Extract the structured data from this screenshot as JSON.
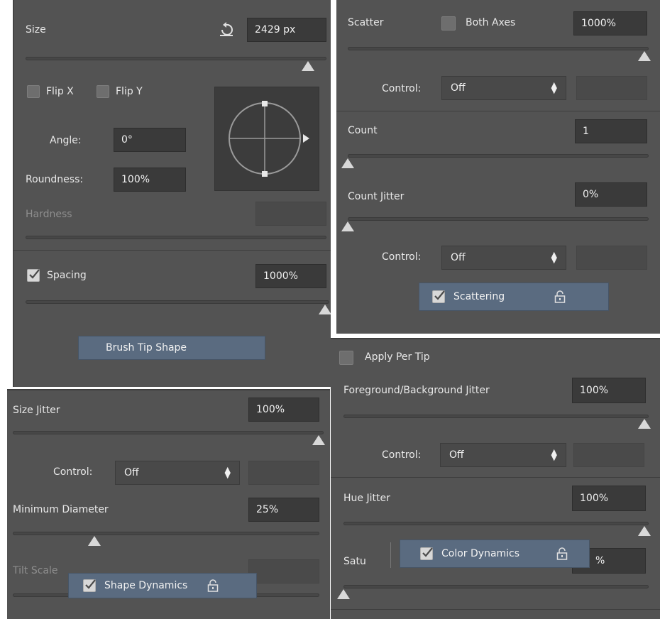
{
  "brush_tip": {
    "size_label": "Size",
    "size_value": "2429 px",
    "size_level": 0.98,
    "flip_x_label": "Flip X",
    "flip_y_label": "Flip Y",
    "angle_label": "Angle:",
    "angle_value": "0°",
    "roundness_label": "Roundness:",
    "roundness_value": "100%",
    "hardness_label": "Hardness",
    "spacing_label": "Spacing",
    "spacing_checked": true,
    "spacing_value": "1000%",
    "spacing_level": 1.0,
    "section_tag": "Brush Tip Shape"
  },
  "shape_dynamics": {
    "size_jitter_label": "Size Jitter",
    "size_jitter_value": "100%",
    "control_label": "Control:",
    "control_value": "Off",
    "min_diameter_label": "Minimum Diameter",
    "min_diameter_value": "25%",
    "min_diameter_level": 0.25,
    "tilt_scale_label": "Tilt Scale",
    "section_tag": "Shape Dynamics"
  },
  "scattering": {
    "scatter_label": "Scatter",
    "both_axes_label": "Both Axes",
    "scatter_value": "1000%",
    "control_label": "Control:",
    "control_value": "Off",
    "count_label": "Count",
    "count_value": "1",
    "count_jitter_label": "Count Jitter",
    "count_jitter_value": "0%",
    "control2_label": "Control:",
    "control2_value": "Off",
    "section_tag": "Scattering"
  },
  "color_dynamics": {
    "apply_per_tip_label": "Apply Per Tip",
    "fg_bg_jitter_label": "Foreground/Background Jitter",
    "fg_bg_jitter_value": "100%",
    "control_label": "Control:",
    "control_value": "Off",
    "hue_jitter_label": "Hue Jitter",
    "hue_jitter_value": "100%",
    "saturation_label_partial": "Satu",
    "saturation_value_partial": "%",
    "section_tag": "Color Dynamics"
  },
  "colors": {
    "panel_bg": "#535353",
    "field_bg": "#3a3a3a",
    "tag_bg": "#5a6b80"
  }
}
